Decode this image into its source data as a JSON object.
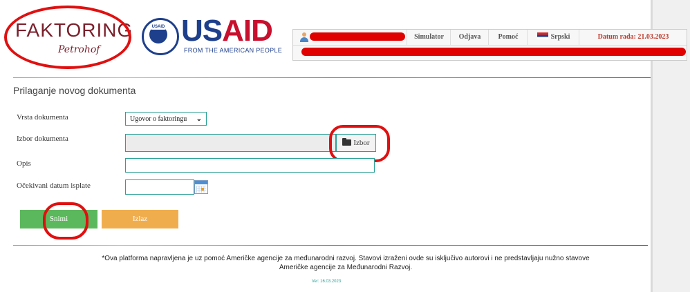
{
  "branding": {
    "faktoring_name": "FAKTORING",
    "faktoring_script": "Petrohof",
    "usaid_word_blue": "US",
    "usaid_word_red": "AID",
    "usaid_seal_tag": "USAID",
    "usaid_tagline": "FROM THE AMERICAN PEOPLE"
  },
  "topnav": {
    "items": [
      "Simulator",
      "Odjava",
      "Pomoć",
      "Srpski"
    ],
    "date_label": "Datum rada: 21.03.2023"
  },
  "page": {
    "title": "Prilaganje novog dokumenta"
  },
  "form": {
    "vrsta_label": "Vrsta dokumenta",
    "vrsta_value": "Ugovor o faktoringu",
    "izbor_label": "Izbor dokumenta",
    "izbor_button": "Izbor",
    "opis_label": "Opis",
    "datum_label": "Očekivani datum isplate"
  },
  "actions": {
    "save": "Snimi",
    "exit": "Izlaz"
  },
  "footer": {
    "line1": "*Ova platforma napravljena je uz pomoć Američke agencije za međunarodni razvoj. Stavovi izraženi ovde su isključivo autorovi i ne predstavljaju nužno stavove",
    "line2": "Američke agencije za Međunarodni Razvoj.",
    "version": "Ver: 16.03.2023"
  },
  "colors": {
    "accent_teal": "#2aa198",
    "save_green": "#5cb85c",
    "exit_orange": "#f0ad4e",
    "annotation_red": "#e01010"
  }
}
